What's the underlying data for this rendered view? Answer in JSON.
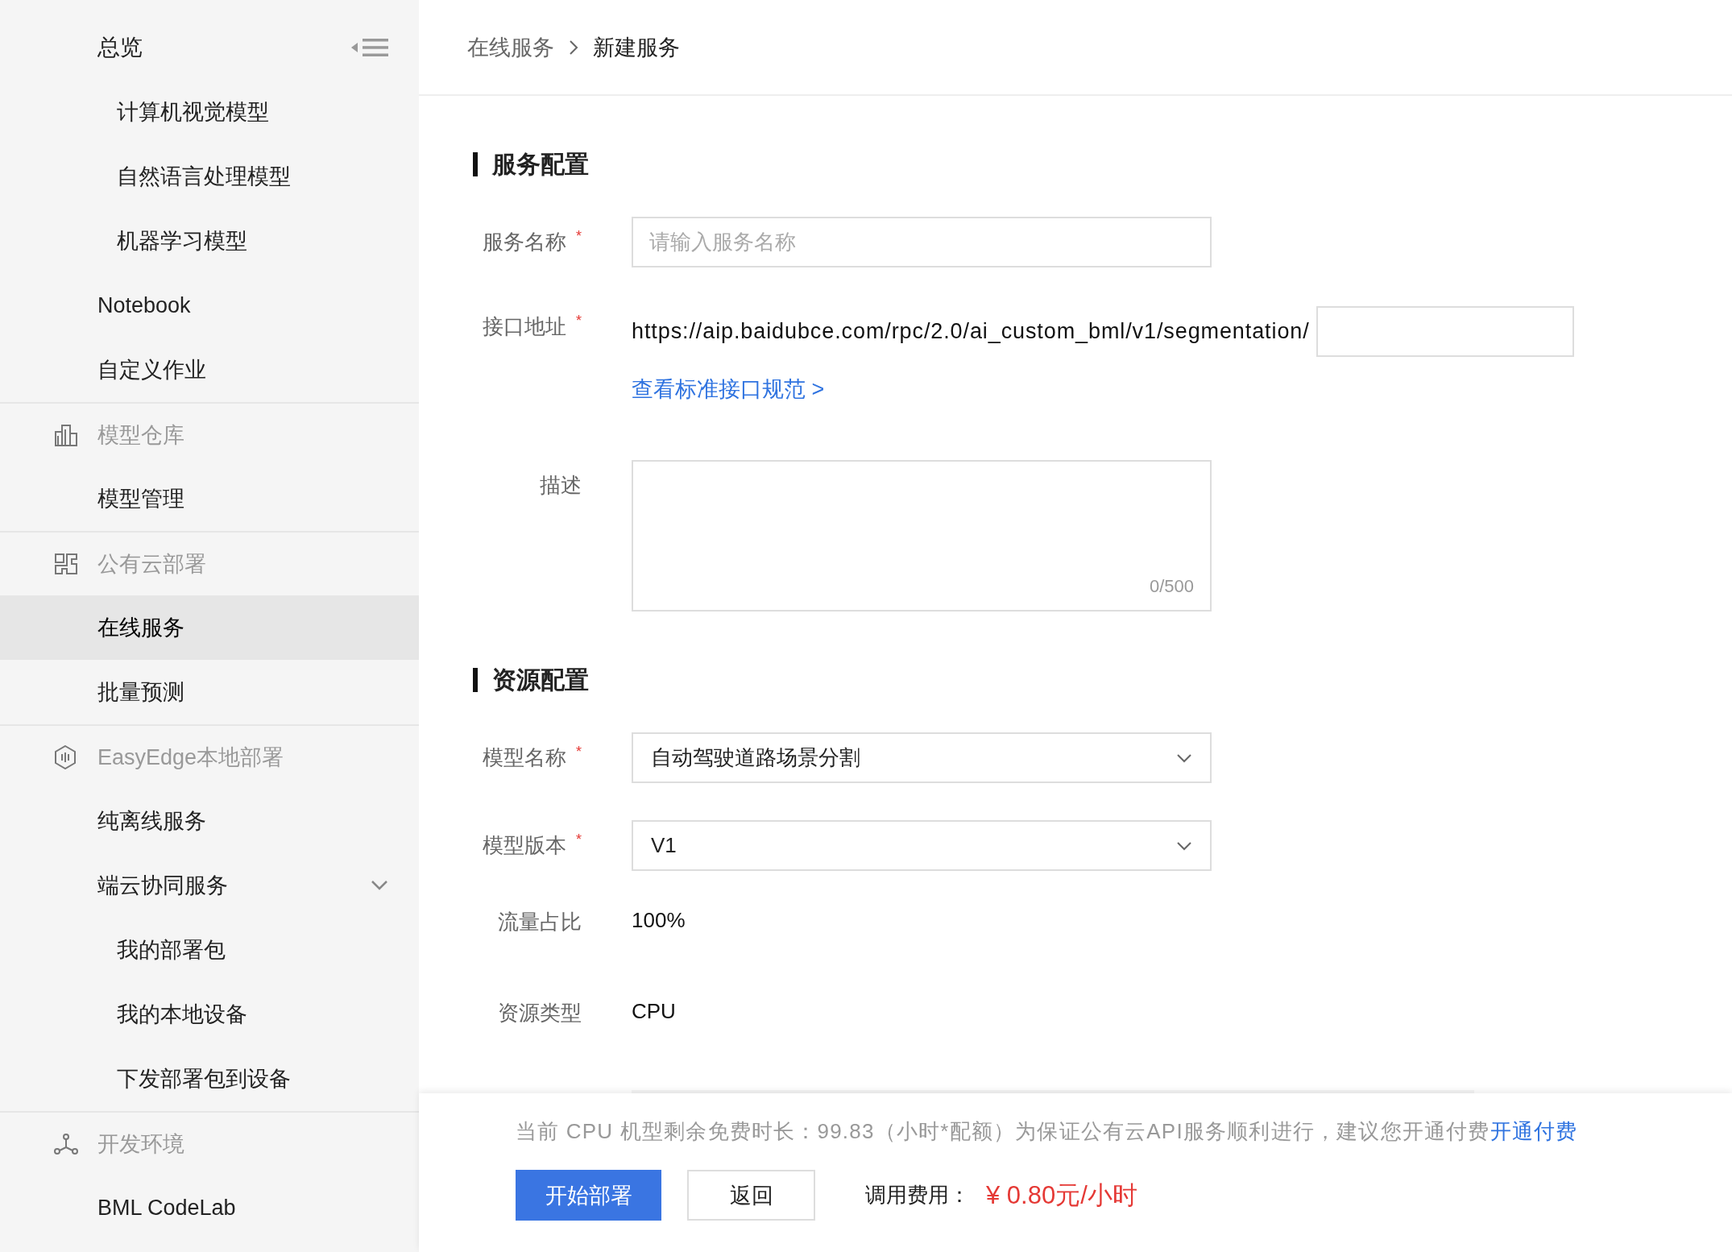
{
  "sidebar": {
    "title": "总览",
    "items": [
      {
        "kind": "sub",
        "label": "计算机视觉模型",
        "selected": false
      },
      {
        "kind": "sub",
        "label": "自然语言处理模型",
        "selected": false
      },
      {
        "kind": "sub",
        "label": "机器学习模型",
        "selected": false
      },
      {
        "kind": "item",
        "label": "Notebook",
        "selected": false
      },
      {
        "kind": "item",
        "label": "自定义作业",
        "selected": false
      },
      {
        "kind": "group",
        "label": "模型仓库",
        "selected": false
      },
      {
        "kind": "item",
        "label": "模型管理",
        "selected": false
      },
      {
        "kind": "group",
        "label": "公有云部署",
        "selected": false
      },
      {
        "kind": "item",
        "label": "在线服务",
        "selected": true
      },
      {
        "kind": "item",
        "label": "批量预测",
        "selected": false
      },
      {
        "kind": "group",
        "label": "EasyEdge本地部署",
        "selected": false
      },
      {
        "kind": "item",
        "label": "纯离线服务",
        "selected": false
      },
      {
        "kind": "item",
        "label": "端云协同服务",
        "selected": false,
        "expanded": true
      },
      {
        "kind": "sub",
        "label": "我的部署包",
        "selected": false
      },
      {
        "kind": "sub",
        "label": "我的本地设备",
        "selected": false
      },
      {
        "kind": "sub",
        "label": "下发部署包到设备",
        "selected": false
      },
      {
        "kind": "group",
        "label": "开发环境",
        "selected": false
      },
      {
        "kind": "item",
        "label": "BML CodeLab",
        "selected": false
      }
    ]
  },
  "breadcrumb": [
    "在线服务",
    "新建服务"
  ],
  "sections": [
    {
      "title": "服务配置",
      "fields": [
        {
          "kind": "input",
          "label": "服务名称",
          "mark": "*",
          "placeholder": "请输入服务名称"
        },
        {
          "kind": "url",
          "label": "接口地址",
          "mark": "*",
          "prefix": "https://aip.baidubce.com/rpc/2.0/ai_custom_bml/v1/segmentation/",
          "link": "查看标准接口规范 >"
        },
        {
          "kind": "textarea",
          "label": "描述",
          "counter": "0/500"
        }
      ]
    },
    {
      "title": "资源配置",
      "fields": [
        {
          "kind": "select",
          "label": "模型名称",
          "mark": "*",
          "value": "自动驾驶道路场景分割"
        },
        {
          "kind": "select",
          "label": "模型版本",
          "mark": "*",
          "value": "V1"
        },
        {
          "kind": "text",
          "label": "流量占比",
          "value": "100%"
        },
        {
          "kind": "text",
          "label": "资源类型",
          "value": "CPU"
        },
        {
          "kind": "strip"
        }
      ]
    }
  ],
  "footer": {
    "notice": "当前 CPU 机型剩余免费时长：99.83（小时*配额）为保证公有云API服务顺利进行，建议您开通付费",
    "notice_link": "开通付费",
    "buttons": [
      {
        "kind": "primary",
        "label": "开始部署"
      },
      {
        "kind": "default",
        "label": "返回"
      }
    ],
    "cost_label": "调用费用：",
    "cost": "¥ 0.80元/小时"
  }
}
